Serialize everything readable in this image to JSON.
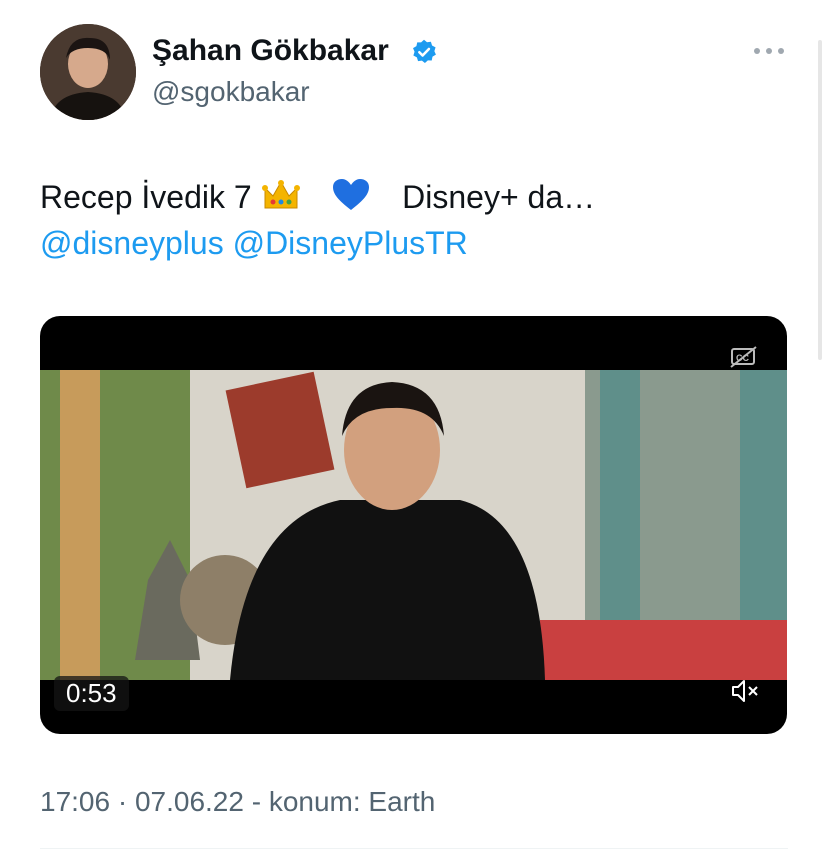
{
  "author": {
    "name": "Şahan Gökbakar",
    "handle": "@sgokbakar",
    "verified_color": "#1d9bf0"
  },
  "tweet": {
    "text_before": "Recep İvedik 7",
    "text_after": "Disney+ da…",
    "emojis": [
      "crown-emoji",
      "blue-heart-emoji"
    ],
    "mentions": [
      "@disneyplus",
      "@DisneyPlusTR"
    ]
  },
  "video": {
    "duration": "0:53",
    "cc_icon": "closed-captions-off-icon",
    "mute_icon": "muted-speaker-icon"
  },
  "meta": {
    "timestamp": "17:06 · 07.06.22 - konum: Earth"
  },
  "colors": {
    "link": "#1d9bf0",
    "secondary_text": "#536471"
  }
}
